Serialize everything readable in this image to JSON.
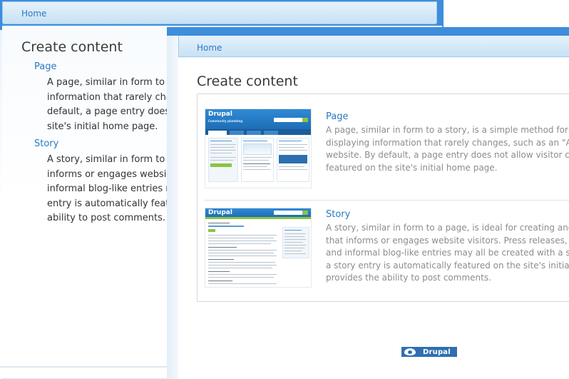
{
  "back_window": {
    "breadcrumb": "Home",
    "title": "Create content",
    "types": [
      {
        "name": "Page",
        "description_lines": [
          "A page, similar in form to a",
          "information that rarely cha",
          "default, a page entry does",
          "site's initial home page."
        ]
      },
      {
        "name": "Story",
        "description_lines": [
          "A story, similar in form to a",
          "informs or engages website",
          "informal blog-like entries m",
          "entry is automatically featu",
          "ability to post comments."
        ]
      }
    ]
  },
  "front_window": {
    "breadcrumb": "Home",
    "title": "Create content",
    "types": [
      {
        "name": "Page",
        "thumbnail": "drupal-front-page-screenshot",
        "description_lines": [
          "A page, similar in form to a story, is a simple method for c",
          "displaying information that rarely changes, such as an \"Ab",
          "website. By default, a page entry does not allow visitor com",
          "featured on the site's initial home page."
        ]
      },
      {
        "name": "Story",
        "thumbnail": "drupal-story-page-screenshot",
        "description_lines": [
          "A story, similar in form to a page, is ideal for creating and",
          "that informs or engages website visitors. Press releases, s",
          "and informal blog-like entries may all be created with a sto",
          "a story entry is automatically featured on the site's initial h",
          "provides the ability to post comments."
        ]
      }
    ],
    "footer_badge": "Drupal"
  },
  "thumbnails": {
    "page_thumb": {
      "logo": "Drupal",
      "tagline": "Community plumbing",
      "search_label": "Search Drupal.org"
    },
    "story_thumb": {
      "logo": "Drupal",
      "article_title": "Video Made with Drupal",
      "sidebar_title": "About Drupal"
    }
  },
  "colors": {
    "frame_blue": "#3d8edb",
    "link_blue": "#2a7ac2",
    "nav_gradient_top": "#e6f2fb",
    "nav_gradient_bottom": "#c7e1f5",
    "description_gray": "#8c8c8c"
  }
}
